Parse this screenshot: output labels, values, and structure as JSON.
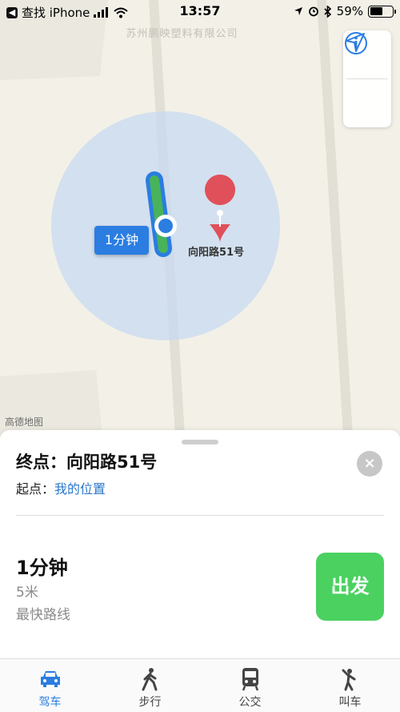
{
  "status_bar": {
    "back_app": "查找 iPhone",
    "time": "13:57",
    "battery_text": "59%",
    "battery_level": 0.59
  },
  "map": {
    "company_label": "苏州鹏映塑料有限公司",
    "destination_label": "向阳路51号",
    "time_bubble": "1分钟",
    "attribution": "高德地图",
    "controls": [
      "info-icon",
      "location-arrow-icon"
    ]
  },
  "sheet": {
    "dest_prefix": "终点：",
    "dest_name": "向阳路51号",
    "start_prefix": "起点：",
    "start_value": "我的位置",
    "close_icon": "×",
    "route_time": "1分钟",
    "route_distance": "5米",
    "route_desc": "最快路线",
    "go_label": "出发"
  },
  "tabs": [
    {
      "label": "驾车",
      "icon": "car-icon",
      "active": true
    },
    {
      "label": "步行",
      "icon": "walk-icon",
      "active": false
    },
    {
      "label": "公交",
      "icon": "bus-icon",
      "active": false
    },
    {
      "label": "叫车",
      "icon": "hail-icon",
      "active": false
    }
  ],
  "colors": {
    "accent": "#2b7de1",
    "go": "#4bd160",
    "route_green": "#48b35a",
    "pin": "#e0505a"
  }
}
